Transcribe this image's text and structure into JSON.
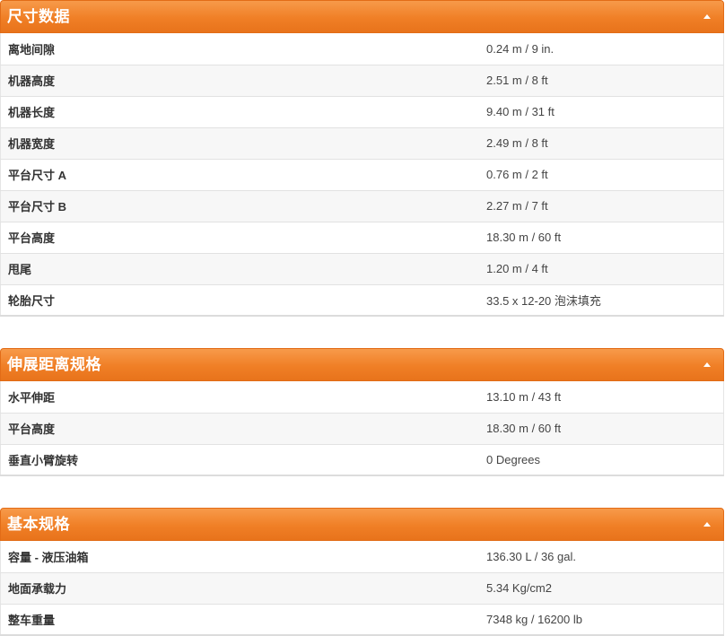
{
  "sections": [
    {
      "title": "尺寸数据",
      "rows": [
        {
          "label": "离地间隙",
          "value": "0.24 m / 9 in."
        },
        {
          "label": "机器高度",
          "value": "2.51 m / 8 ft"
        },
        {
          "label": "机器长度",
          "value": "9.40 m / 31 ft"
        },
        {
          "label": "机器宽度",
          "value": "2.49 m / 8 ft"
        },
        {
          "label": "平台尺寸 A",
          "value": "0.76 m / 2 ft"
        },
        {
          "label": "平台尺寸 B",
          "value": "2.27 m / 7 ft"
        },
        {
          "label": "平台高度",
          "value": "18.30 m / 60 ft"
        },
        {
          "label": "甩尾",
          "value": "1.20 m / 4 ft"
        },
        {
          "label": "轮胎尺寸",
          "value": "33.5 x 12-20 泡沫填充"
        }
      ]
    },
    {
      "title": "伸展距离规格",
      "rows": [
        {
          "label": "水平伸距",
          "value": "13.10 m / 43 ft"
        },
        {
          "label": "平台高度",
          "value": "18.30 m / 60 ft"
        },
        {
          "label": "垂直小臂旋转",
          "value": "0 Degrees"
        }
      ]
    },
    {
      "title": "基本规格",
      "rows": [
        {
          "label": "容量 - 液压油箱",
          "value": "136.30 L / 36 gal."
        },
        {
          "label": "地面承载力",
          "value": "5.34 Kg/cm2"
        },
        {
          "label": "整车重量",
          "value": "7348 kg / 16200 lb"
        }
      ]
    }
  ],
  "icons": {
    "collapse": "chevron-up-icon"
  },
  "colors": {
    "header_top": "#f79a4a",
    "header_bottom": "#e8731b",
    "row_alt": "#f7f7f7",
    "border": "#e2e2e2"
  }
}
